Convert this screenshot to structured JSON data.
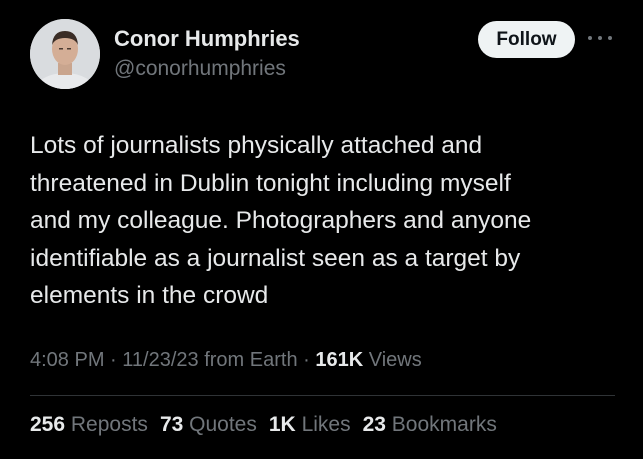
{
  "author": {
    "name": "Conor Humphries",
    "handle": "@conorhumphries"
  },
  "header": {
    "follow_label": "Follow",
    "more_icon": "more-horizontal-icon"
  },
  "tweet": {
    "lines": [
      "Lots of journalists physically attached and",
      "threatened in Dublin tonight including myself",
      "and my colleague. Photographers and anyone",
      "identifiable as a journalist seen as a target by",
      "elements in the crowd"
    ]
  },
  "meta": {
    "time": "4:08 PM",
    "date": "11/23/23",
    "source": "from Earth",
    "views_count": "161K",
    "views_label": "Views"
  },
  "stats": {
    "reposts": {
      "count": "256",
      "label": "Reposts"
    },
    "quotes": {
      "count": "73",
      "label": "Quotes"
    },
    "likes": {
      "count": "1K",
      "label": "Likes"
    },
    "bookmarks": {
      "count": "23",
      "label": "Bookmarks"
    }
  },
  "colors": {
    "background": "#000000",
    "primary_text": "#e7e9ea",
    "secondary_text": "#71767b",
    "button_bg": "#eff3f4"
  }
}
